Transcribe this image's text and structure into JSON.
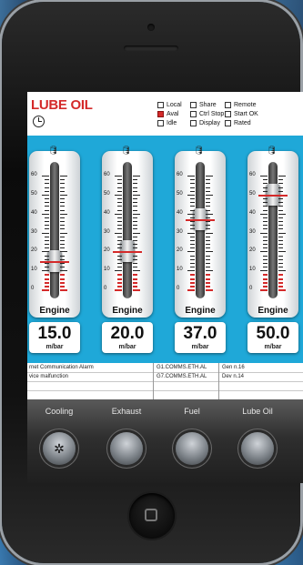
{
  "app": {
    "title": "LUBE OIL"
  },
  "status": [
    {
      "label": "Local",
      "checked": false
    },
    {
      "label": "Share",
      "checked": false
    },
    {
      "label": "Remote",
      "checked": false
    },
    {
      "label": "Aval",
      "checked": true
    },
    {
      "label": "Ctrl Stop",
      "checked": false
    },
    {
      "label": "Start OK",
      "checked": false
    },
    {
      "label": "Idle",
      "checked": false
    },
    {
      "label": "Display",
      "checked": false
    },
    {
      "label": "Rated",
      "checked": false
    }
  ],
  "scale": {
    "ticks": [
      "60",
      "50",
      "40",
      "30",
      "20",
      "10",
      "0"
    ]
  },
  "gauges": [
    {
      "label": "Engine",
      "value": "15.0",
      "unit": "m/bar",
      "level": 15
    },
    {
      "label": "Engine",
      "value": "20.0",
      "unit": "m/bar",
      "level": 20
    },
    {
      "label": "Engine",
      "value": "37.0",
      "unit": "m/bar",
      "level": 37
    },
    {
      "label": "Engine",
      "value": "50.0",
      "unit": "m/bar",
      "level": 50
    }
  ],
  "alarms": [
    {
      "message": "rnet Communication Alarm",
      "tag": "G1.COMMS.ETH.AL",
      "source": "Gen n.16"
    },
    {
      "message": "vice malfunction",
      "tag": "G7.COMMS.ETH.AL",
      "source": "Dev n.14"
    },
    {
      "message": "",
      "tag": "",
      "source": ""
    },
    {
      "message": "",
      "tag": "",
      "source": ""
    }
  ],
  "controls": [
    {
      "label": "Cooling",
      "icon": "gear-icon"
    },
    {
      "label": "Exhaust",
      "icon": ""
    },
    {
      "label": "Fuel",
      "icon": ""
    },
    {
      "label": "Lube Oil",
      "icon": ""
    }
  ],
  "colors": {
    "accent": "#d42a2a",
    "panel": "#1fa8d8"
  }
}
